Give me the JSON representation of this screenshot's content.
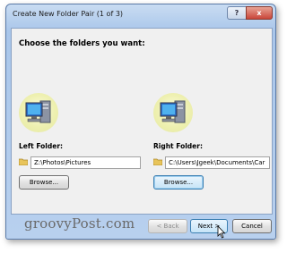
{
  "window": {
    "title": "Create New Folder Pair (1 of 3)",
    "help_label": "?",
    "close_label": "x"
  },
  "panel": {
    "heading": "Choose the folders you want:"
  },
  "left": {
    "label": "Left Folder:",
    "path": "Z:\\Photos\\Pictures",
    "browse_label": "Browse..."
  },
  "right": {
    "label": "Right Folder:",
    "path": "C:\\Users\\Jgeek\\Documents\\Car",
    "browse_label": "Browse..."
  },
  "footer": {
    "back_label": "< Back",
    "next_label": "Next >",
    "cancel_label": "Cancel"
  },
  "watermark": "groovyPost.com",
  "icons": {
    "computer": "computer-icon",
    "folder": "folder-icon",
    "cursor": "mouse-cursor-icon"
  }
}
